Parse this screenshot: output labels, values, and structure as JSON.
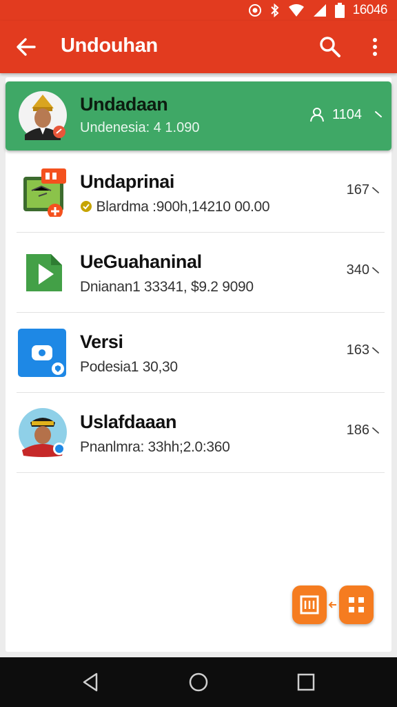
{
  "status_bar": {
    "time": "16046"
  },
  "app_bar": {
    "title": "Undouhan",
    "back_icon": "arrow-left-icon",
    "search_icon": "search-icon",
    "more_icon": "more-vert-icon"
  },
  "colors": {
    "primary": "#e23b1f",
    "active_item": "#3fa866",
    "fab": "#f57c20"
  },
  "active_item": {
    "name": "Undadaan",
    "detail": "Undenesia: 4 1.090",
    "count": "1104"
  },
  "items": [
    {
      "name": "Undaprinai",
      "detail": "Blardma :900h,14210 00.00",
      "count": "167",
      "icon": "presentation-icon"
    },
    {
      "name": "UeGuahaninal",
      "detail": "Dnianan1 33341, $9.2 9090",
      "count": "340",
      "icon": "play-file-icon"
    },
    {
      "name": "Versi",
      "detail": "Podesia1 30,30",
      "count": "163",
      "icon": "camera-app-icon"
    },
    {
      "name": "Uslafdaaan",
      "detail": "Pnanlmra: 33hh;2.0:360",
      "count": "186",
      "icon": "avatar-icon"
    }
  ],
  "nav": {
    "back": "nav-back-icon",
    "home": "nav-home-icon",
    "recents": "nav-recents-icon"
  }
}
